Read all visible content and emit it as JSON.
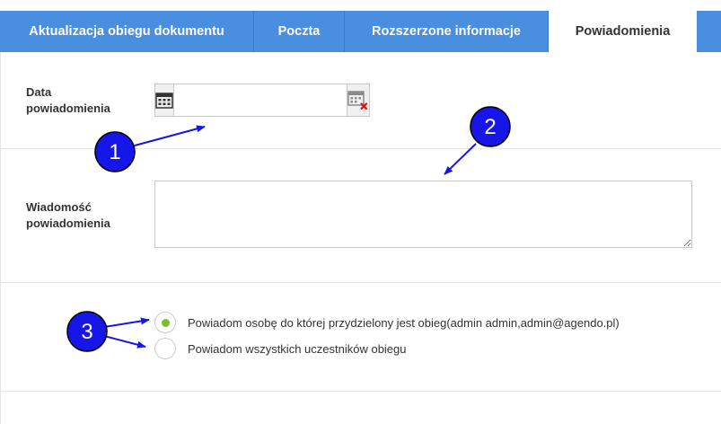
{
  "tabs": [
    {
      "label": "Aktualizacja obiegu dokumentu",
      "active": false
    },
    {
      "label": "Poczta",
      "active": false
    },
    {
      "label": "Rozszerzone informacje",
      "active": false
    },
    {
      "label": "Powiadomienia",
      "active": true
    }
  ],
  "form": {
    "date_label": "Data\npowiadomienia",
    "date_value": "",
    "message_label": "Wiadomość\npowiadomienia",
    "message_value": "",
    "radio_options": [
      {
        "label": "Powiadom osobę do której przydzielony jest obieg(admin admin,admin@agendo.pl)",
        "selected": true
      },
      {
        "label": "Powiadom wszystkich uczestników obiegu",
        "selected": false
      }
    ]
  },
  "annotations": {
    "badge_1": "1",
    "badge_2": "2",
    "badge_3": "3"
  },
  "icons": {
    "calendar": "calendar-icon",
    "calendar_clear": "calendar-clear-icon"
  },
  "colors": {
    "tab_blue": "#4a8ee0",
    "badge_blue": "#1616e8",
    "radio_selected": "#7cbf2a"
  }
}
